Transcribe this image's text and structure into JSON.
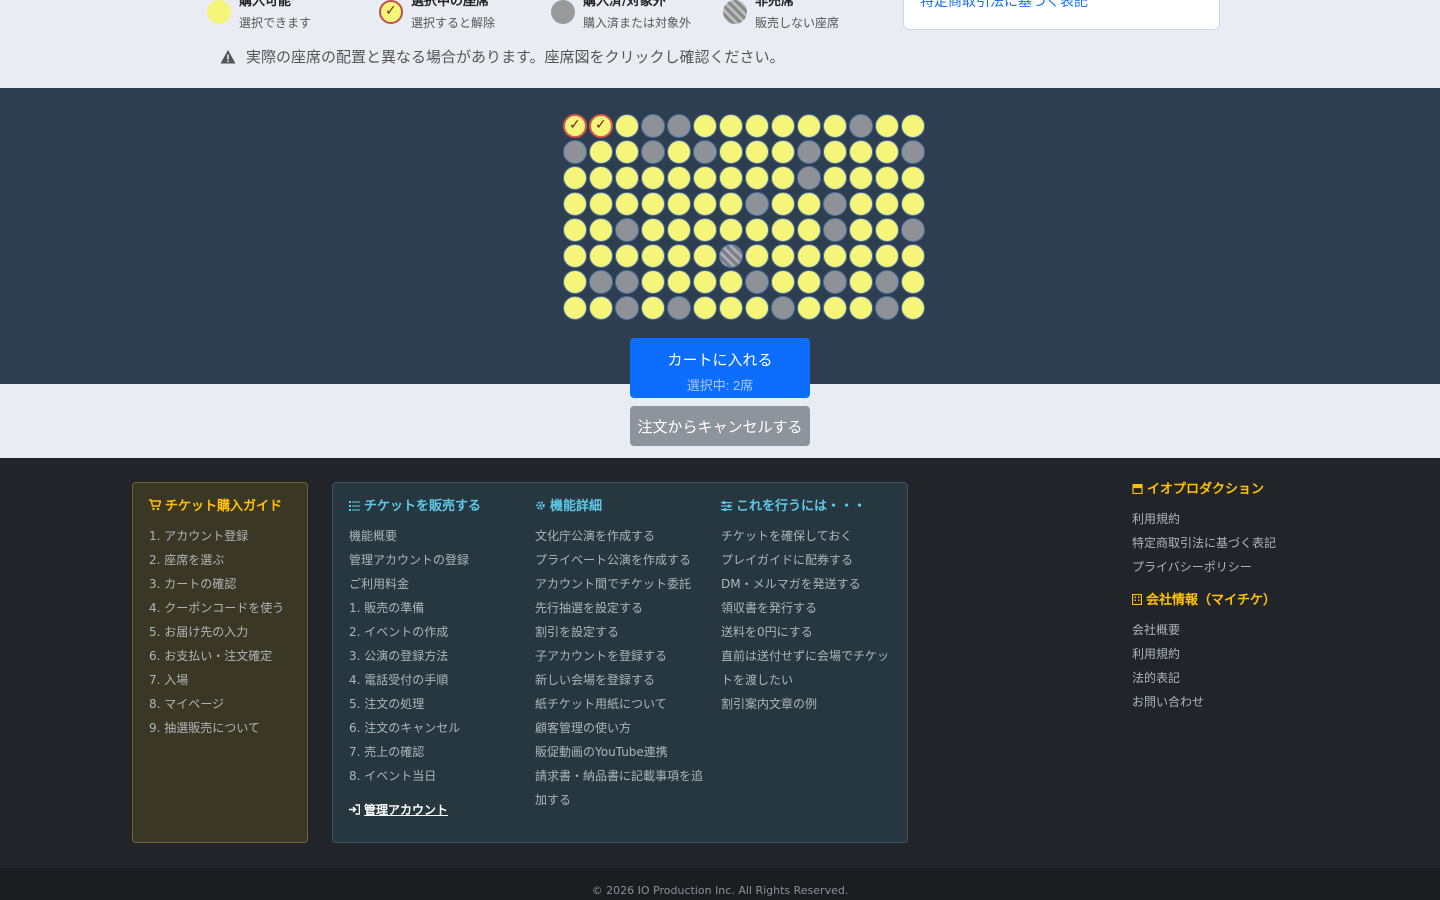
{
  "legend": [
    {
      "title": "購入可能",
      "sub": "選択できます",
      "type": "available"
    },
    {
      "title": "選択中の座席",
      "sub": "選択すると解除",
      "type": "selected"
    },
    {
      "title": "購入済/対象外",
      "sub": "購入済または対象外",
      "type": "purchased"
    },
    {
      "title": "非売席",
      "sub": "販売しない座席",
      "type": "not-for-sale"
    }
  ],
  "law_link": "特定商取引法に基づく表記",
  "notice": "実際の座席の配置と異なる場合があります。座席図をクリックし確認ください。",
  "seat_rows": [
    "SSAPPAAAAAAPA",
    "PAAPAPAAAPAAAP",
    "AAAAAAAAAPAAAA",
    "AAAAAAAPAAPAAA",
    "AAPAAAAAAAPAAP",
    "AAAAAANAAAAAAA",
    "APPAAAAPAAPAPA",
    "AAPAPAAAPAAAPA"
  ],
  "seat_legend_codes": {
    "A": "available",
    "S": "selected",
    "P": "purchased",
    "N": "not-for-sale"
  },
  "cart": {
    "label": "カートに入れる",
    "selected": "選択中: 2席"
  },
  "cancel_label": "注文からキャンセルする",
  "guide": {
    "title": "チケット購入ガイド",
    "items": [
      "1. アカウント登録",
      "2. 座席を選ぶ",
      "3. カートの確認",
      "4. クーポンコードを使う",
      "5. お届け先の入力",
      "6. お支払い・注文確定",
      "7. 入場",
      "8. マイページ",
      "9. 抽選販売について"
    ]
  },
  "sell": {
    "title": "チケットを販売する",
    "items": [
      "機能概要",
      "管理アカウントの登録",
      "ご利用料金",
      "1. 販売の準備",
      "2. イベントの作成",
      "3. 公演の登録方法",
      "4. 電話受付の手順",
      "5. 注文の処理",
      "6. 注文のキャンセル",
      "7. 売上の確認",
      "8. イベント当日"
    ],
    "admin": "管理アカウント"
  },
  "features": {
    "title": "機能詳細",
    "items": [
      "文化庁公演を作成する",
      "プライベート公演を作成する",
      "アカウント間でチケット委託",
      "先行抽選を設定する",
      "割引を設定する",
      "子アカウントを登録する",
      "新しい会場を登録する",
      "紙チケット用紙について",
      "顧客管理の使い方",
      "販促動画のYouTube連携",
      "請求書・納品書に記載事項を追加する"
    ]
  },
  "howto": {
    "title": "これを行うには・・・",
    "items": [
      "チケットを確保しておく",
      "プレイガイドに配券する",
      "DM・メルマガを発送する",
      "領収書を発行する",
      "送料を0円にする",
      "直前は送付せずに会場でチケットを渡したい",
      "割引案内文章の例"
    ]
  },
  "company": {
    "title": "イオプロダクション",
    "items": [
      "利用規約",
      "特定商取引法に基づく表記",
      "プライバシーポリシー"
    ]
  },
  "company2": {
    "title": "会社情報（マイチケ）",
    "items": [
      "会社概要",
      "利用規約",
      "法的表記",
      "お問い合わせ"
    ]
  },
  "copyright": "© 2026 IO Production Inc. All Rights Reserved."
}
